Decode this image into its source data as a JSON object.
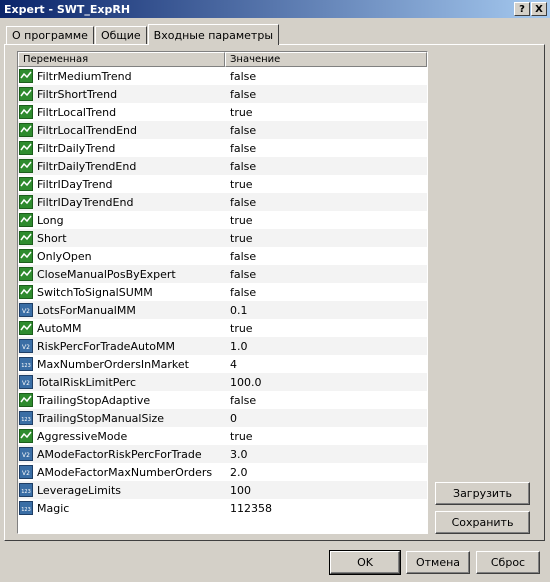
{
  "window": {
    "title": "Expert - SWT_ExpRH",
    "help_label": "?",
    "close_label": "X"
  },
  "tabs": [
    {
      "label": "О программе"
    },
    {
      "label": "Общие"
    },
    {
      "label": "Входные параметры"
    }
  ],
  "grid": {
    "columns": {
      "variable": "Переменная",
      "value": "Значение"
    },
    "rows": [
      {
        "name": "FiltrMediumTrend",
        "value": "false",
        "icon": "bool-icon"
      },
      {
        "name": "FiltrShortTrend",
        "value": "false",
        "icon": "bool-icon"
      },
      {
        "name": "FiltrLocalTrend",
        "value": "true",
        "icon": "bool-icon"
      },
      {
        "name": "FiltrLocalTrendEnd",
        "value": "false",
        "icon": "bool-icon"
      },
      {
        "name": "FiltrDailyTrend",
        "value": "false",
        "icon": "bool-icon"
      },
      {
        "name": "FiltrDailyTrendEnd",
        "value": "false",
        "icon": "bool-icon"
      },
      {
        "name": "FiltrIDayTrend",
        "value": "true",
        "icon": "bool-icon"
      },
      {
        "name": "FiltrIDayTrendEnd",
        "value": "false",
        "icon": "bool-icon"
      },
      {
        "name": "Long",
        "value": "true",
        "icon": "bool-icon"
      },
      {
        "name": "Short",
        "value": "true",
        "icon": "bool-icon"
      },
      {
        "name": "OnlyOpen",
        "value": "false",
        "icon": "bool-icon"
      },
      {
        "name": "CloseManualPosByExpert",
        "value": "false",
        "icon": "bool-icon"
      },
      {
        "name": "SwitchToSignalSUMM",
        "value": "false",
        "icon": "bool-icon"
      },
      {
        "name": "LotsForManualMM",
        "value": "0.1",
        "icon": "double-icon"
      },
      {
        "name": "AutoMM",
        "value": "true",
        "icon": "bool-icon"
      },
      {
        "name": "RiskPercForTradeAutoMM",
        "value": "1.0",
        "icon": "double-icon"
      },
      {
        "name": "MaxNumberOrdersInMarket",
        "value": "4",
        "icon": "int-icon"
      },
      {
        "name": "TotalRiskLimitPerc",
        "value": "100.0",
        "icon": "double-icon"
      },
      {
        "name": "TrailingStopAdaptive",
        "value": "false",
        "icon": "bool-icon"
      },
      {
        "name": "TrailingStopManualSize",
        "value": "0",
        "icon": "int-icon"
      },
      {
        "name": "AggressiveMode",
        "value": "true",
        "icon": "bool-icon"
      },
      {
        "name": "AModeFactorRiskPercForTrade",
        "value": "3.0",
        "icon": "double-icon"
      },
      {
        "name": "AModeFactorMaxNumberOrders",
        "value": "2.0",
        "icon": "double-icon"
      },
      {
        "name": "LeverageLimits",
        "value": "100",
        "icon": "int-icon"
      },
      {
        "name": "Magic",
        "value": "112358",
        "icon": "int-icon"
      }
    ]
  },
  "buttons": {
    "load": "Загрузить",
    "save": "Сохранить",
    "ok": "OK",
    "cancel": "Отмена",
    "reset": "Сброс"
  },
  "icon_text": {
    "double": "V2",
    "int": "123"
  },
  "colors": {
    "titlebar_start": "#0a246a",
    "titlebar_end": "#a6caf0",
    "face": "#d4d0c8",
    "bool_icon": "#2e8b2e"
  }
}
